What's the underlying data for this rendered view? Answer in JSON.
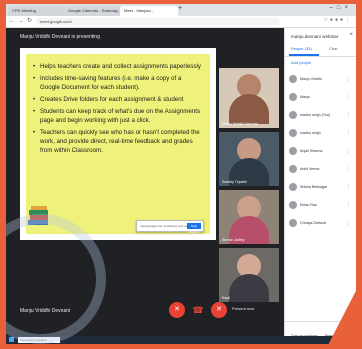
{
  "browser": {
    "tabs": [
      "CPD Meeting",
      "Google Calendar - Saturday, 18",
      "Meet - Manjula..."
    ],
    "url": "meet.google.com/"
  },
  "meet": {
    "presenting_label": "Manju Vriddhi Devnani is presenting",
    "slide_bullets": [
      "Helps teachers create and collect assignments paperlessly",
      "Includes time-saving features (i.e. make a copy of a Google Document for each student).",
      "Creates Drive folders for each assignment & student",
      "Students can keep track of what's due on the Assignments page and begin working with just a click.",
      "Teachers can quickly see who has or hasn't completed the work, and provide direct, real-time feedback and grades from within Classroom."
    ],
    "popup_text": "meet.google.com is sharing your screen.",
    "popup_button": "Stop sharing",
    "tiles": [
      "Manju Vriddhi Devnani",
      "Sweety Tripathi",
      "Simran Jaitley",
      "Kapil"
    ],
    "meeting_name": "Manju Vriddhi Devnani",
    "present_now": "Present now"
  },
  "sidebar": {
    "title": "manju.devnani webinar",
    "tabs": {
      "people": "People (33)",
      "chat": "Chat"
    },
    "add_people": "Add people",
    "participants": [
      "Manju Vriddhi",
      "Manju",
      "madhu singh (You)",
      "madhu singh",
      "Anjali Sharma",
      "Ankit Verma",
      "Shikha Bhitnagar",
      "Kirtan Rao",
      "Chhaya Dwivedi"
    ],
    "footer": {
      "captions": "Turn on captions",
      "present": "Present now"
    }
  },
  "taskbar": {
    "search_placeholder": "Type here to search"
  },
  "colors": {
    "accent": "#1a73e8",
    "end_call": "#ea4335",
    "slide_bg": "#eef27a",
    "frame": "#e8613a"
  }
}
